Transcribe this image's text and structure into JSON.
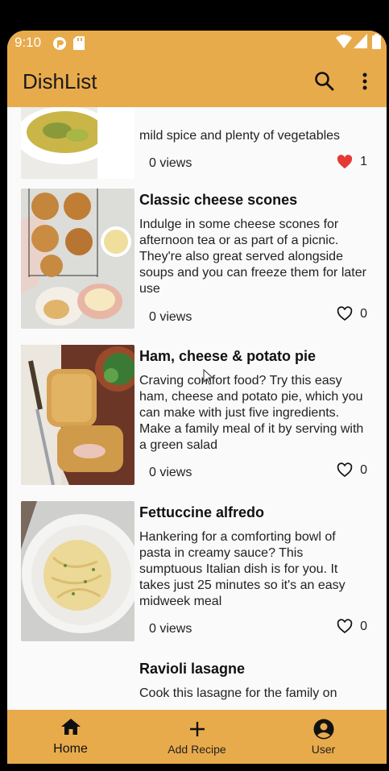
{
  "status_bar": {
    "time": "9:10"
  },
  "app_bar": {
    "title": "DishList",
    "search_icon": "search-icon",
    "menu_icon": "more-vert-icon"
  },
  "recipes": [
    {
      "title": "",
      "description": "mild spice and plenty of vegetables",
      "views": "0 views",
      "likes": "1",
      "liked": true
    },
    {
      "title": "Classic cheese scones",
      "description": "Indulge in some cheese scones for afternoon tea or as part of a picnic. They're also great served alongside soups and you can freeze them for later use",
      "views": "0 views",
      "likes": "0",
      "liked": false
    },
    {
      "title": "Ham, cheese & potato pie",
      "description": "Craving comfort food? Try this easy ham, cheese and potato pie, which you can make with just five ingredients. Make a family meal of it by serving with a green salad",
      "views": "0 views",
      "likes": "0",
      "liked": false
    },
    {
      "title": "Fettuccine alfredo",
      "description": "Hankering for a comforting bowl of pasta in creamy sauce? This sumptuous Italian dish is for you. It takes just 25 minutes so it's an easy midweek meal",
      "views": "0 views",
      "likes": "0",
      "liked": false
    },
    {
      "title": "Ravioli lasagne",
      "description": "Cook this lasagne for the family on",
      "views": "",
      "likes": "",
      "liked": false
    }
  ],
  "bottom_nav": [
    {
      "label": "Home",
      "icon": "home-icon",
      "active": true
    },
    {
      "label": "Add Recipe",
      "icon": "plus-icon",
      "active": false
    },
    {
      "label": "User",
      "icon": "account-circle-icon",
      "active": false
    }
  ],
  "colors": {
    "accent": "#e8ab4c",
    "liked": "#e53935",
    "background": "#fafafa"
  }
}
